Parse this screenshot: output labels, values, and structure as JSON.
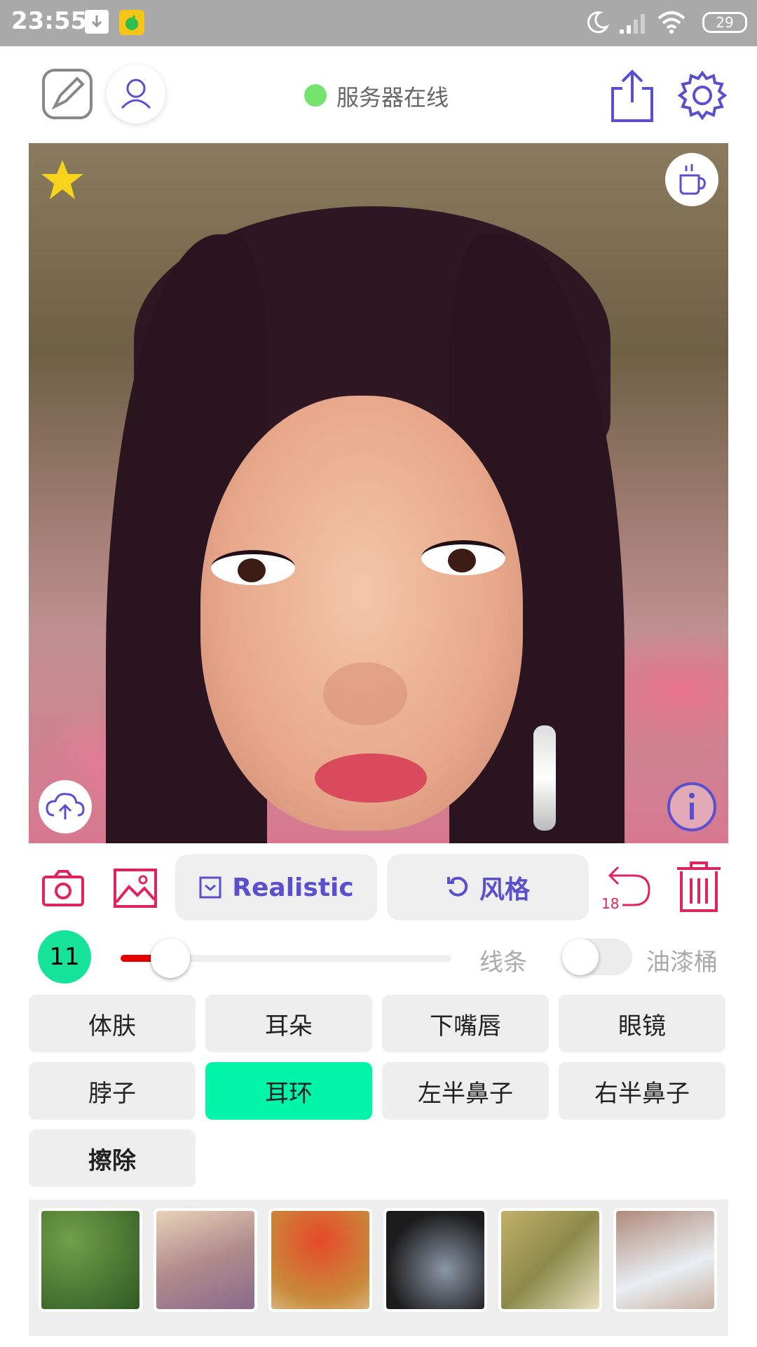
{
  "status_bar": {
    "time": "23:55",
    "battery": "29"
  },
  "header": {
    "server_status": "服务器在线",
    "server_status_color": "#77e36f"
  },
  "toolbar": {
    "style_mode_label": "Realistic",
    "style_button_label": "风格",
    "undo_count": "18"
  },
  "slider": {
    "brush_size": "11",
    "value_fraction": 0.15,
    "line_label": "线条",
    "bucket_label": "油漆桶",
    "bucket_enabled": false
  },
  "parts": [
    {
      "label": "体肤"
    },
    {
      "label": "耳朵"
    },
    {
      "label": "下嘴唇"
    },
    {
      "label": "眼镜"
    },
    {
      "label": "脖子"
    },
    {
      "label": "耳环"
    },
    {
      "label": "左半鼻子"
    },
    {
      "label": "右半鼻子"
    },
    {
      "label": "擦除"
    }
  ],
  "active_part": "耳环",
  "colors": {
    "accent": "#5a4fcf",
    "danger": "#e0245e",
    "active": "#00f5a8",
    "badge": "#15e39a"
  }
}
